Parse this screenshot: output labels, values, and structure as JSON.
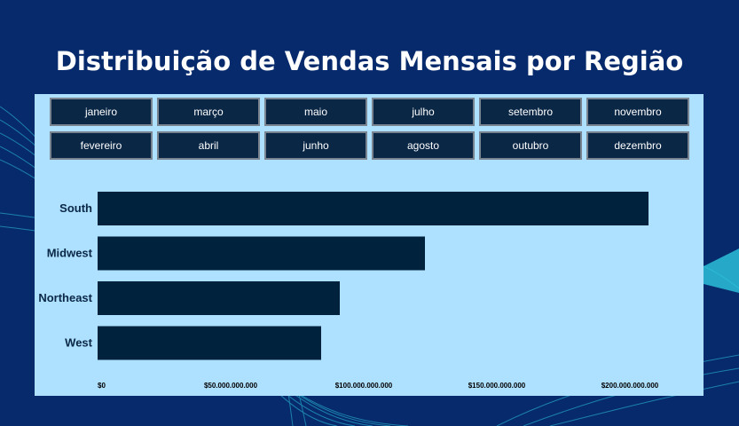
{
  "title": "Distribuição de Vendas Mensais por Região",
  "months": {
    "row1": [
      "janeiro",
      "março",
      "maio",
      "julho",
      "setembro",
      "novembro"
    ],
    "row2": [
      "fevereiro",
      "abril",
      "junho",
      "agosto",
      "outubro",
      "dezembro"
    ]
  },
  "colors": {
    "background": "#062a6b",
    "panel": "#aee0ff",
    "bar": "#00223d",
    "button": "#0a2746",
    "wave": "#2ec8e0"
  },
  "chart_data": {
    "type": "bar",
    "orientation": "horizontal",
    "categories": [
      "South",
      "Midwest",
      "Northeast",
      "West"
    ],
    "values": [
      207000000000,
      123000000000,
      91000000000,
      84000000000
    ],
    "xlim": [
      0,
      200000000000
    ],
    "xticks": [
      0,
      50000000000,
      100000000000,
      150000000000,
      200000000000
    ],
    "xtick_labels": [
      "$0",
      "$50.000.000.000",
      "$100.000.000.000",
      "$150.000.000.000",
      "$200.000.000.000"
    ],
    "grid": false,
    "title": "",
    "xlabel": "",
    "ylabel": ""
  }
}
